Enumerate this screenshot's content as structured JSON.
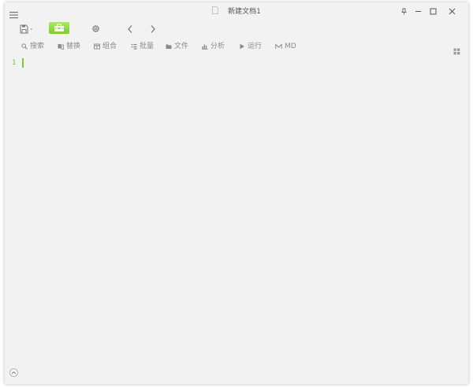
{
  "window": {
    "title": "新建文档1"
  },
  "titlebar": {
    "menu_icon": "hamburger-icon",
    "doc_icon": "document-icon",
    "controls": [
      "pin-icon",
      "minimize-icon",
      "maximize-icon",
      "close-icon"
    ]
  },
  "toolbar": {
    "save_icon": "save-icon",
    "toolbox_icon": "toolbox-icon",
    "settings_icon": "gear-icon",
    "back_icon": "chevron-left-icon",
    "forward_icon": "chevron-right-icon",
    "accent": "#7ccd2c"
  },
  "subtoolbar": {
    "items": [
      {
        "label": "搜索",
        "icon": "search-icon"
      },
      {
        "label": "替换",
        "icon": "replace-icon"
      },
      {
        "label": "组合",
        "icon": "table-icon"
      },
      {
        "label": "批量",
        "icon": "list-icon"
      },
      {
        "label": "文件",
        "icon": "folder-icon"
      },
      {
        "label": "分析",
        "icon": "bar-chart-icon"
      },
      {
        "label": "运行",
        "icon": "play-icon"
      },
      {
        "label": "MD",
        "icon": "markdown-icon"
      }
    ],
    "grid_icon": "grid-icon"
  },
  "editor": {
    "line_numbers": [
      "1"
    ],
    "content": ""
  },
  "footer": {
    "toggle_icon": "chevron-up-icon"
  }
}
